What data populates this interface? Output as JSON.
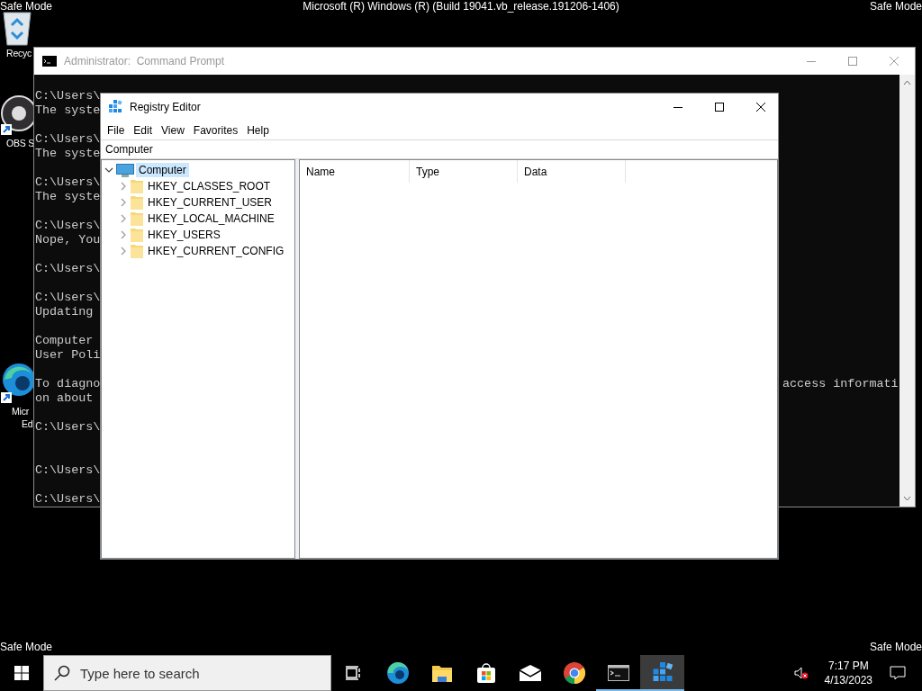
{
  "desktop": {
    "corner_labels": [
      "Safe Mode",
      "Safe Mode",
      "Safe Mode",
      "Safe Mode"
    ],
    "build_label": "Microsoft (R) Windows (R) (Build 19041.vb_release.191206-1406)",
    "icons": [
      {
        "kind": "recycle-bin",
        "label_lines": [
          "Recyc"
        ]
      },
      {
        "kind": "obs",
        "label_lines": [
          "OBS S"
        ]
      },
      {
        "kind": "edge",
        "label_lines": [
          "Micr",
          "Ed"
        ]
      }
    ]
  },
  "command_prompt": {
    "title": "Administrator:  Command Prompt",
    "lines": [
      {
        "text": "C:\\Users\\",
        "blank_before": false
      },
      {
        "text": "The syste",
        "blank_before": false
      },
      {
        "text": "C:\\Users\\",
        "blank_before": true
      },
      {
        "text": "The syste",
        "blank_before": false
      },
      {
        "text": "C:\\Users\\",
        "blank_before": true
      },
      {
        "text": "The syste",
        "blank_before": false
      },
      {
        "text": "C:\\Users\\",
        "blank_before": true
      },
      {
        "text": "Nope, You",
        "blank_before": false
      },
      {
        "text": "C:\\Users\\",
        "blank_before": true
      },
      {
        "text": "C:\\Users\\",
        "blank_before": true
      },
      {
        "text": "Updating",
        "blank_before": false
      },
      {
        "text": "Computer",
        "blank_before": true
      },
      {
        "text": "User Poli",
        "blank_before": false
      },
      {
        "text": "To diagno",
        "right": "access informati",
        "blank_before": true
      },
      {
        "text": "on about",
        "blank_before": false
      },
      {
        "text": "C:\\Users\\",
        "blank_before": true
      },
      {
        "text": "C:\\Users\\",
        "blank_before": true,
        "double_blank": true
      },
      {
        "text": "C:\\Users\\",
        "blank_before": true
      }
    ]
  },
  "registry_editor": {
    "title": "Registry Editor",
    "menu": [
      "File",
      "Edit",
      "View",
      "Favorites",
      "Help"
    ],
    "address": "Computer",
    "tree": [
      {
        "label": "Computer",
        "kind": "computer",
        "expanded": true,
        "selected": true,
        "children": [
          {
            "label": "HKEY_CLASSES_ROOT",
            "kind": "folder",
            "expanded": false,
            "selected": false
          },
          {
            "label": "HKEY_CURRENT_USER",
            "kind": "folder",
            "expanded": false,
            "selected": false
          },
          {
            "label": "HKEY_LOCAL_MACHINE",
            "kind": "folder",
            "expanded": false,
            "selected": false
          },
          {
            "label": "HKEY_USERS",
            "kind": "folder",
            "expanded": false,
            "selected": false
          },
          {
            "label": "HKEY_CURRENT_CONFIG",
            "kind": "folder",
            "expanded": false,
            "selected": false
          }
        ]
      }
    ],
    "columns": [
      "Name",
      "Type",
      "Data"
    ]
  },
  "taskbar": {
    "search_placeholder": "Type here to search",
    "apps": [
      {
        "kind": "task-view",
        "running": false,
        "selected": false
      },
      {
        "kind": "edge",
        "running": false,
        "selected": false
      },
      {
        "kind": "explorer",
        "running": false,
        "selected": false
      },
      {
        "kind": "store",
        "running": false,
        "selected": false
      },
      {
        "kind": "mail",
        "running": false,
        "selected": false
      },
      {
        "kind": "chrome",
        "running": false,
        "selected": false
      },
      {
        "kind": "console",
        "running": true,
        "selected": false
      },
      {
        "kind": "registry",
        "running": true,
        "selected": true
      }
    ],
    "volume_muted": true,
    "clock": {
      "time": "7:17 PM",
      "date": "4/13/2023"
    }
  }
}
